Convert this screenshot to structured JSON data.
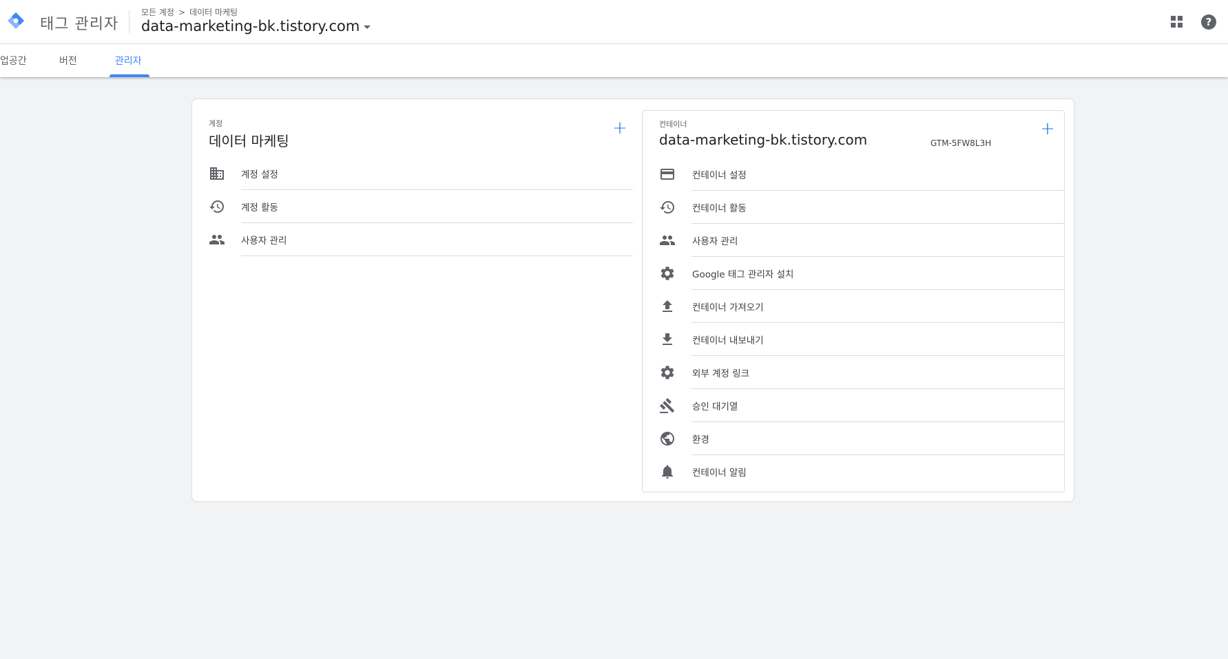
{
  "header": {
    "product_name": "태그 관리자",
    "breadcrumb": {
      "all_accounts": "모든 계정",
      "separator": ">",
      "account": "데이터 마케팅"
    },
    "container_name": "data-marketing-bk.tistory.com",
    "icons": {
      "logo": "gtm-logo-icon",
      "apps": "apps-grid-icon",
      "help": "help-icon"
    },
    "help_symbol": "?"
  },
  "tabs": [
    {
      "label": "업공간"
    },
    {
      "label": "버전"
    },
    {
      "label": "관리자",
      "active": true
    }
  ],
  "account_section": {
    "label": "계정",
    "title": "데이터 마케팅",
    "add_symbol": "+",
    "items": [
      {
        "label": "계정 설정",
        "icon": "building-icon"
      },
      {
        "label": "계정 활동",
        "icon": "history-icon"
      },
      {
        "label": "사용자 관리",
        "icon": "people-icon"
      }
    ]
  },
  "container_section": {
    "label": "컨테이너",
    "title": "data-marketing-bk.tistory.com",
    "container_id": "GTM-5FW8L3H",
    "add_symbol": "+",
    "items": [
      {
        "label": "컨테이너 설정",
        "icon": "web-window-icon"
      },
      {
        "label": "컨테이너 활동",
        "icon": "history-icon"
      },
      {
        "label": "사용자 관리",
        "icon": "people-icon"
      },
      {
        "label": "Google 태그 관리자 설치",
        "icon": "gear-icon"
      },
      {
        "label": "컨테이너 가져오기",
        "icon": "upload-icon"
      },
      {
        "label": "컨테이너 내보내기",
        "icon": "download-icon"
      },
      {
        "label": "외부 계정 링크",
        "icon": "gear-icon"
      },
      {
        "label": "승인 대기열",
        "icon": "gavel-icon"
      },
      {
        "label": "환경",
        "icon": "globe-icon"
      },
      {
        "label": "컨테이너 알림",
        "icon": "bell-icon"
      }
    ]
  },
  "colors": {
    "accent": "#4285f4",
    "icon_gray": "#5f6368",
    "background": "#f1f3f4"
  }
}
